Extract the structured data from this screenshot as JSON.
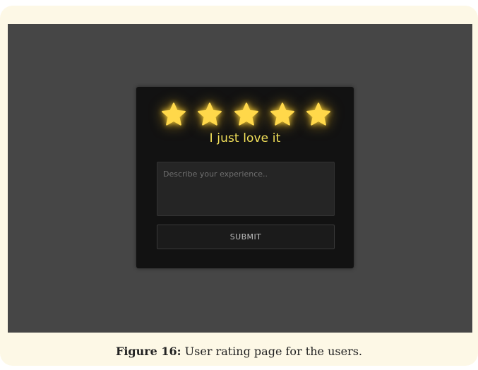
{
  "rating": {
    "stars_total": 5,
    "stars_selected": 5,
    "star_icon": "star-icon",
    "star_color": "#FFD84A",
    "label": "I just love it",
    "label_color": "#F4E25A"
  },
  "feedback": {
    "value": "",
    "placeholder": "Describe your experience.."
  },
  "submit": {
    "label": "SUBMIT"
  },
  "caption": {
    "label": "Figure 16:",
    "text": " User rating page for the users."
  }
}
